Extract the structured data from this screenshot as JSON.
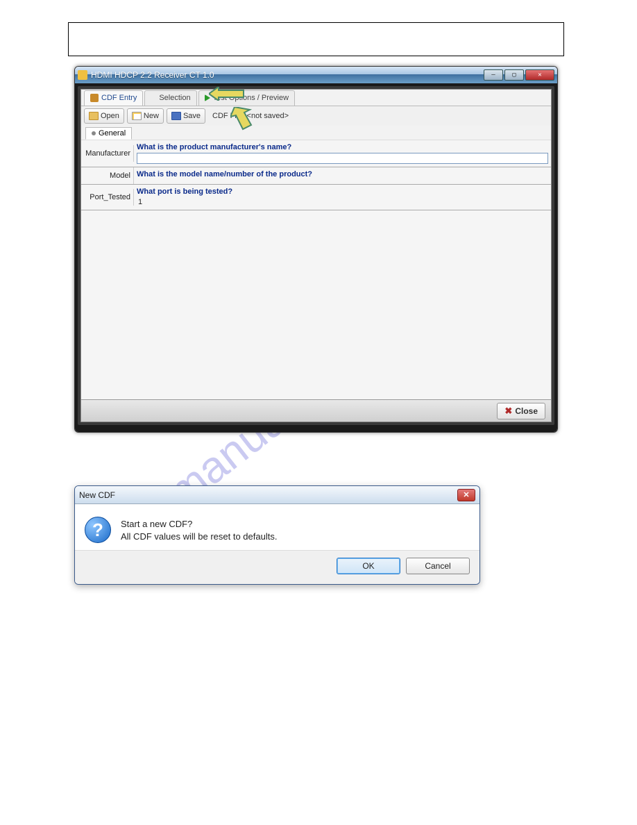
{
  "window": {
    "title": "HDMI HDCP 2.2 Receiver CT 1.0",
    "tabs": [
      {
        "label": "CDF Entry",
        "active": true
      },
      {
        "label": "Selection",
        "active": false,
        "partial": true
      },
      {
        "label": "Test Options / Preview",
        "active": false
      }
    ],
    "toolbar": {
      "open_label": "Open",
      "new_label": "New",
      "save_label": "Save",
      "file_status_prefix": "CDF File:",
      "file_status_value": "<not saved>"
    },
    "subtab": {
      "label": "General"
    },
    "form": {
      "rows": [
        {
          "label": "Manufacturer",
          "question": "What is the product manufacturer's name?",
          "value": ""
        },
        {
          "label": "Model",
          "question": "What is the model name/number of the product?",
          "value": ""
        },
        {
          "label": "Port_Tested",
          "question": "What port is being tested?",
          "value": "1"
        }
      ]
    },
    "close_label": "Close"
  },
  "dialog": {
    "title": "New CDF",
    "line1": "Start a new CDF?",
    "line2": "All CDF values will be reset to defaults.",
    "ok_label": "OK",
    "cancel_label": "Cancel"
  },
  "watermark": "manualshive.com"
}
